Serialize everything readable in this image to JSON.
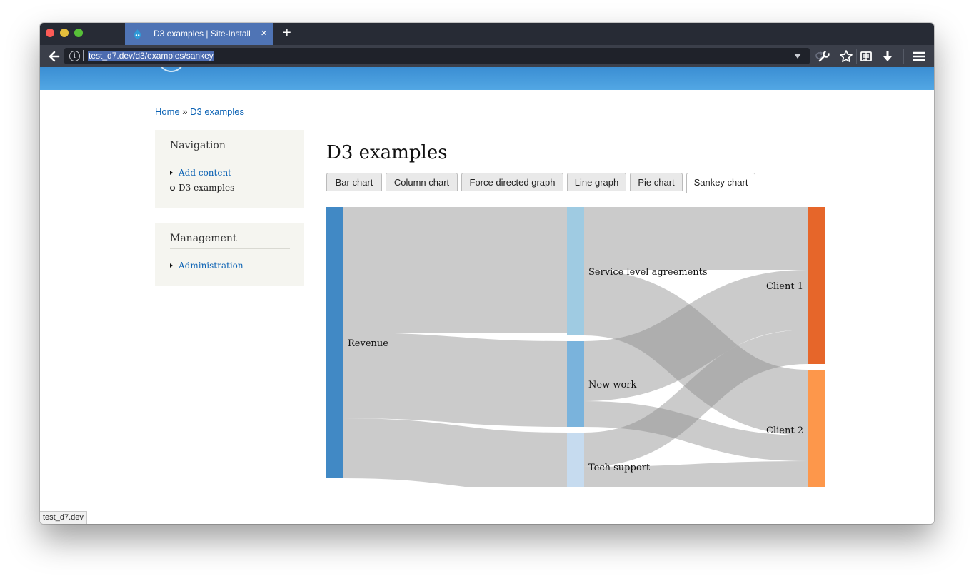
{
  "browser": {
    "tab_title": "D3 examples | Site-Install",
    "tab_close": "×",
    "new_tab": "+",
    "url": "test_d7.dev/d3/examples/sankey",
    "info_glyph": "i",
    "status_url": "test_d7.dev"
  },
  "breadcrumb": {
    "home": "Home",
    "separator": " » ",
    "current": "D3 examples"
  },
  "sidebar": {
    "navigation": {
      "title": "Navigation",
      "items": [
        {
          "label": "Add content",
          "link": true
        },
        {
          "label": "D3 examples",
          "link": false
        }
      ]
    },
    "management": {
      "title": "Management",
      "items": [
        {
          "label": "Administration",
          "link": true
        }
      ]
    }
  },
  "main": {
    "title": "D3 examples",
    "tabs": [
      {
        "label": "Bar chart"
      },
      {
        "label": "Column chart"
      },
      {
        "label": "Force directed graph"
      },
      {
        "label": "Line graph"
      },
      {
        "label": "Pie chart"
      },
      {
        "label": "Sankey chart",
        "active": true
      }
    ]
  },
  "colors": {
    "revenue": "#4189c5",
    "service": "#9fcbe2",
    "newwork": "#7ab3dc",
    "techsupport": "#c6dbef",
    "client1": "#e6662a",
    "client2": "#fd974b",
    "link": "#8c8c8c"
  },
  "chart_data": {
    "type": "sankey",
    "nodes": [
      {
        "id": "revenue",
        "name": "Revenue",
        "column": 0,
        "value": 95
      },
      {
        "id": "service",
        "name": "Service level agreements",
        "column": 1,
        "value": 45
      },
      {
        "id": "newwork",
        "name": "New work",
        "column": 1,
        "value": 30
      },
      {
        "id": "techsupport",
        "name": "Tech support",
        "column": 1,
        "value": 24
      },
      {
        "id": "client1",
        "name": "Client 1",
        "column": 2,
        "value": 55
      },
      {
        "id": "client2",
        "name": "Client 2",
        "column": 2,
        "value": 42
      }
    ],
    "links": [
      {
        "source": "revenue",
        "target": "service",
        "value": 44
      },
      {
        "source": "revenue",
        "target": "newwork",
        "value": 30
      },
      {
        "source": "revenue",
        "target": "techsupport",
        "value": 21
      },
      {
        "source": "service",
        "target": "client1",
        "value": 22
      },
      {
        "source": "service",
        "target": "client2",
        "value": 23
      },
      {
        "source": "newwork",
        "target": "client1",
        "value": 21
      },
      {
        "source": "newwork",
        "target": "client2",
        "value": 9
      },
      {
        "source": "techsupport",
        "target": "client1",
        "value": 12
      },
      {
        "source": "techsupport",
        "target": "client2",
        "value": 12
      }
    ]
  }
}
